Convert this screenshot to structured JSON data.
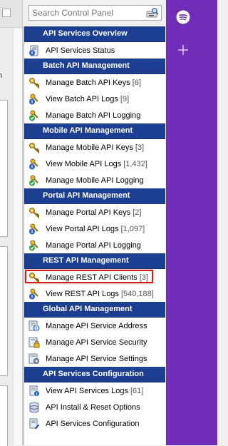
{
  "search": {
    "placeholder": "Search Control Panel"
  },
  "left": {
    "tab_letter": "n"
  },
  "sections": [
    {
      "title": "API Services Overview",
      "items": [
        {
          "label": "API Services Status",
          "count": "",
          "icon": "status-icon"
        }
      ]
    },
    {
      "title": "Batch API Management",
      "items": [
        {
          "label": "Manage Batch API Keys",
          "count": "[6]",
          "icon": "keys-icon"
        },
        {
          "label": "View Batch API Logs",
          "count": "[9]",
          "icon": "logs-icon"
        },
        {
          "label": "Manage Batch API Logging",
          "count": "",
          "icon": "logging-icon"
        }
      ]
    },
    {
      "title": "Mobile API Management",
      "items": [
        {
          "label": "Manage Mobile API Keys",
          "count": "[3]",
          "icon": "keys-icon"
        },
        {
          "label": "View Mobile API Logs",
          "count": "[1,432]",
          "icon": "logs-icon"
        },
        {
          "label": "Manage Mobile API Logging",
          "count": "",
          "icon": "logging-icon"
        }
      ]
    },
    {
      "title": "Portal API Management",
      "items": [
        {
          "label": "Manage Portal API Keys",
          "count": "[2]",
          "icon": "keys-icon"
        },
        {
          "label": "View Portal API Logs",
          "count": "[1,097]",
          "icon": "logs-icon"
        },
        {
          "label": "Manage Portal API Logging",
          "count": "",
          "icon": "logging-icon"
        }
      ]
    },
    {
      "title": "REST API Management",
      "items": [
        {
          "label": "Manage REST API Clients",
          "count": "[3]",
          "icon": "keys-icon",
          "highlighted": true
        },
        {
          "label": "View REST API Logs",
          "count": "[540,188]",
          "icon": "logs-icon"
        }
      ]
    },
    {
      "title": "Global API Management",
      "items": [
        {
          "label": "Manage API Service Address",
          "count": "",
          "icon": "address-icon"
        },
        {
          "label": "Manage API Service Security",
          "count": "",
          "icon": "security-icon"
        },
        {
          "label": "Manage API Service Settings",
          "count": "",
          "icon": "settings-icon"
        }
      ]
    },
    {
      "title": "API Services Configuration",
      "items": [
        {
          "label": "View API Services Logs",
          "count": "[61]",
          "icon": "services-logs-icon"
        },
        {
          "label": "API Install & Reset Options",
          "count": "",
          "icon": "install-icon"
        },
        {
          "label": "API Services Configuration",
          "count": "",
          "icon": "configuration-icon"
        }
      ]
    }
  ],
  "colors": {
    "section_header_bg": "#1d3f92",
    "highlight_border": "#d11a1a",
    "sidebar_purple": "#6f2eb5"
  }
}
